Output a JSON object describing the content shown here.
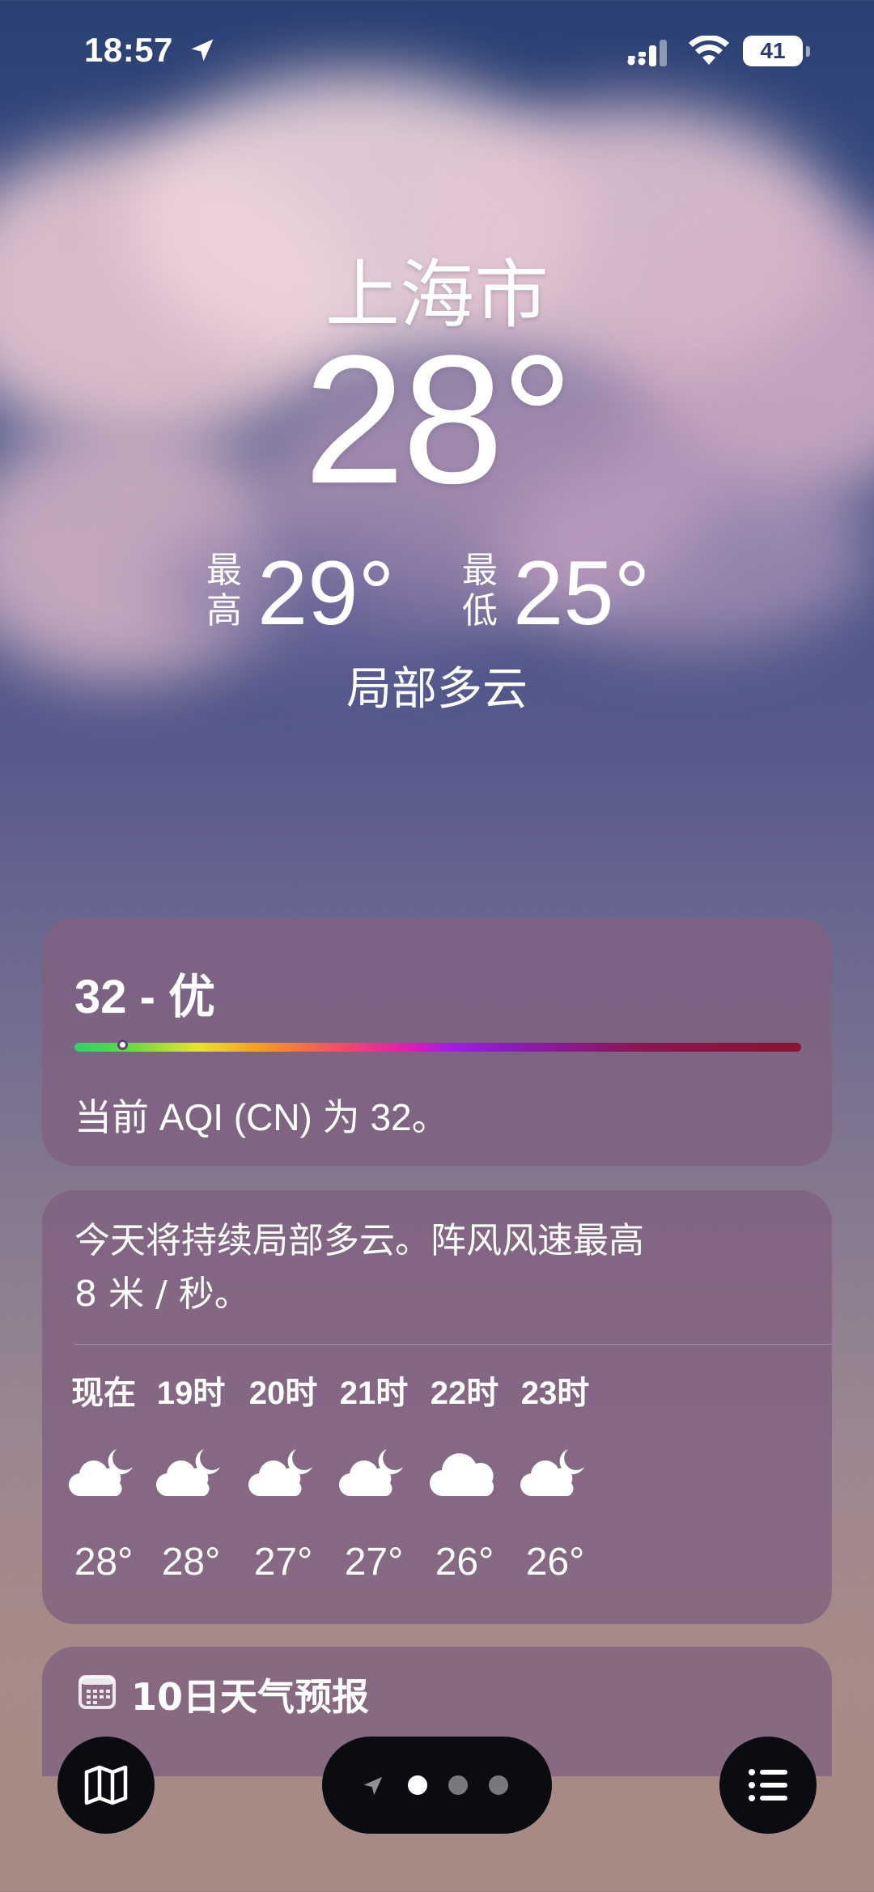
{
  "status_bar": {
    "time": "18:57",
    "battery": "41",
    "icons": [
      "location-arrow-icon",
      "cellular-signal-icon",
      "wifi-icon",
      "battery-icon"
    ]
  },
  "hero": {
    "city": "上海市",
    "temperature": "28°",
    "high_label": "最高",
    "high_value": "29°",
    "low_label": "最低",
    "low_value": "25°",
    "condition": "局部多云"
  },
  "aqi": {
    "value_text": "32 - 优",
    "description": "当前 AQI (CN) 为 32。",
    "marker_fraction": 0.066
  },
  "hourly": {
    "summary_line1": "今天将持续局部多云。阵风风速最高",
    "summary_line2": "8 米 / 秒。",
    "hours": [
      {
        "label": "现在",
        "icon": "partly-cloudy-night-icon",
        "temp": "28°"
      },
      {
        "label": "19时",
        "icon": "partly-cloudy-night-icon",
        "temp": "28°"
      },
      {
        "label": "20时",
        "icon": "partly-cloudy-night-icon",
        "temp": "27°"
      },
      {
        "label": "21时",
        "icon": "partly-cloudy-night-icon",
        "temp": "27°"
      },
      {
        "label": "22时",
        "icon": "cloud-icon",
        "temp": "26°"
      },
      {
        "label": "23时",
        "icon": "partly-cloudy-night-icon",
        "temp": "26°"
      }
    ]
  },
  "forecast": {
    "title": "10日天气预报",
    "icon": "calendar-icon"
  },
  "bottom_bar": {
    "map_icon": "map-icon",
    "list_icon": "list-icon",
    "page_count": 3,
    "current_page": 1
  },
  "colors": {
    "card_bg": "#80627f",
    "pill_bg": "#0b0b12",
    "text": "#ffffff"
  }
}
